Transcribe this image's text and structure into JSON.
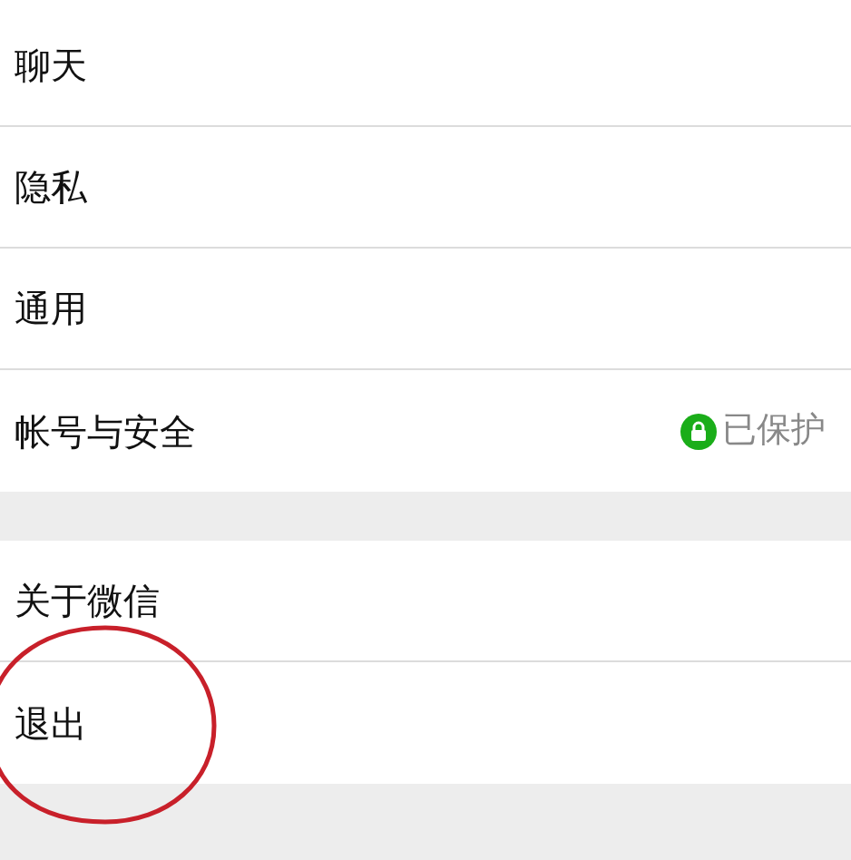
{
  "sections": [
    {
      "items": [
        {
          "label": "聊天"
        },
        {
          "label": "隐私"
        },
        {
          "label": "通用"
        },
        {
          "label": "帐号与安全",
          "status": "已保护"
        }
      ]
    },
    {
      "items": [
        {
          "label": "关于微信"
        },
        {
          "label": "退出"
        }
      ]
    }
  ]
}
